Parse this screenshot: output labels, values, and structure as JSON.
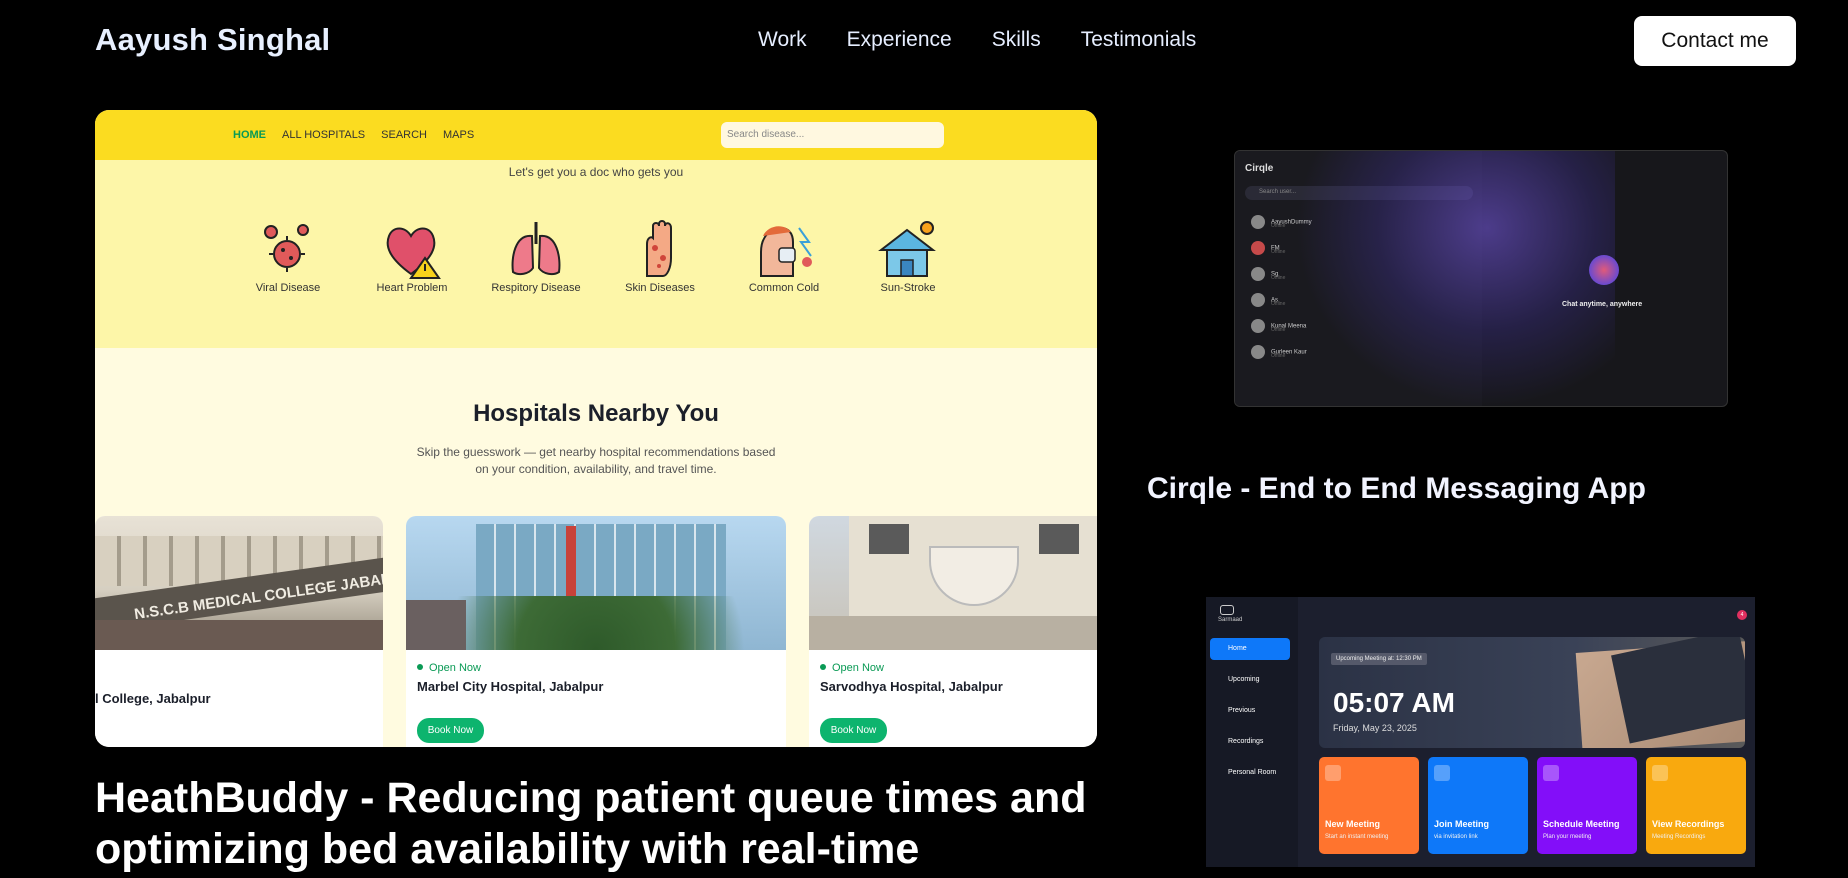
{
  "nav": {
    "brand": "Aayush Singhal",
    "links": [
      "Work",
      "Experience",
      "Skills",
      "Testimonials"
    ],
    "contact": "Contact me"
  },
  "healthbuddy": {
    "menu": [
      "HOME",
      "ALL HOSPITALS",
      "SEARCH",
      "MAPS"
    ],
    "search_placeholder": "Search disease...",
    "tagline": "Let's get you a doc who gets you",
    "diseases": [
      "Viral Disease",
      "Heart Problem",
      "Respitory Disease",
      "Skin Diseases",
      "Common Cold",
      "Sun-Stroke"
    ],
    "section_title": "Hospitals Nearby You",
    "section_desc": "Skip the guesswork — get nearby hospital recommendations based on your condition, availability, and travel time.",
    "hospitals": [
      {
        "name": "l College, Jabalpur",
        "open": "",
        "book": "",
        "sign": "N.S.C.B MEDICAL COLLEGE JABALPUR"
      },
      {
        "name": "Marbel City Hospital, Jabalpur",
        "open": "Open Now",
        "book": "Book Now"
      },
      {
        "name": "Sarvodhya Hospital, Jabalpur",
        "open": "Open Now",
        "book": "Book Now"
      }
    ],
    "project_title": "HeathBuddy - Reducing patient queue times and optimizing bed availability with real-time"
  },
  "cirqle": {
    "app_name": "Cirqle",
    "search_placeholder": "Search user...",
    "users": [
      {
        "name": "AayushDummy",
        "status": "Offline"
      },
      {
        "name": "FM",
        "status": "Offline"
      },
      {
        "name": "Sg",
        "status": "Offline"
      },
      {
        "name": "As",
        "status": "Offline"
      },
      {
        "name": "Kunal Meena",
        "status": "Offline"
      },
      {
        "name": "Gurleen Kaur",
        "status": "Offline"
      }
    ],
    "chat_text": "Chat anytime, anywhere",
    "project_title": "Cirqle - End to End Messaging App"
  },
  "sarmaad": {
    "app_name": "Sarmaad",
    "notification_count": "4",
    "sidebar": [
      "Home",
      "Upcoming",
      "Previous",
      "Recordings",
      "Personal Room"
    ],
    "upcoming_label": "Upcoming Meeting at: 12:30 PM",
    "time": "05:07 AM",
    "date": "Friday, May 23, 2025",
    "tiles": [
      {
        "title": "New Meeting",
        "sub": "Start an instant meeting",
        "color": "#ff742e"
      },
      {
        "title": "Join Meeting",
        "sub": "via invitation link",
        "color": "#0e78f9"
      },
      {
        "title": "Schedule Meeting",
        "sub": "Plan your meeting",
        "color": "#830ef9"
      },
      {
        "title": "View Recordings",
        "sub": "Meeting Recordings",
        "color": "#f9a90e"
      }
    ]
  }
}
